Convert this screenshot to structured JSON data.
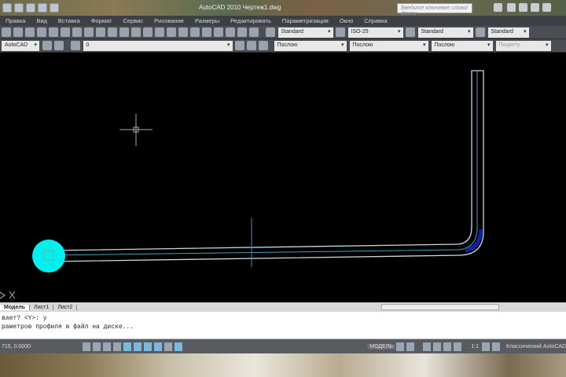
{
  "title": "AutoCAD 2010   Чертеж1.dwg",
  "search_placeholder": "Введите ключевое слово/фразу",
  "menu": [
    "Правка",
    "Вид",
    "Вставка",
    "Формат",
    "Сервис",
    "Рисование",
    "Размеры",
    "Редактировать",
    "Параметризация",
    "Окно",
    "Справка"
  ],
  "toolbar1": {
    "text_style": "Standard",
    "dim_style": "ISO-25",
    "table_style": "Standard",
    "mleader_style": "Standard"
  },
  "toolbar2": {
    "workspace": "AutoCAD",
    "layer": "0",
    "color": "Послою",
    "linetype": "Послою",
    "lineweight": "Послою",
    "plotstyle": "Поцвету"
  },
  "tabs": [
    "Модель",
    "Лист1",
    "Лист2"
  ],
  "command_lines": [
    "вает? <Y>: y",
    "раметров профиля в файл на диске..."
  ],
  "status": {
    "coords": "715, 0.0000",
    "model": "МОДЕЛЬ",
    "scale": "1:1",
    "workspace": "Классический AutoCAD"
  },
  "colors": {
    "pipe": "#c8d8e0",
    "circle": "#00f0f0",
    "canvas": "#000000"
  }
}
